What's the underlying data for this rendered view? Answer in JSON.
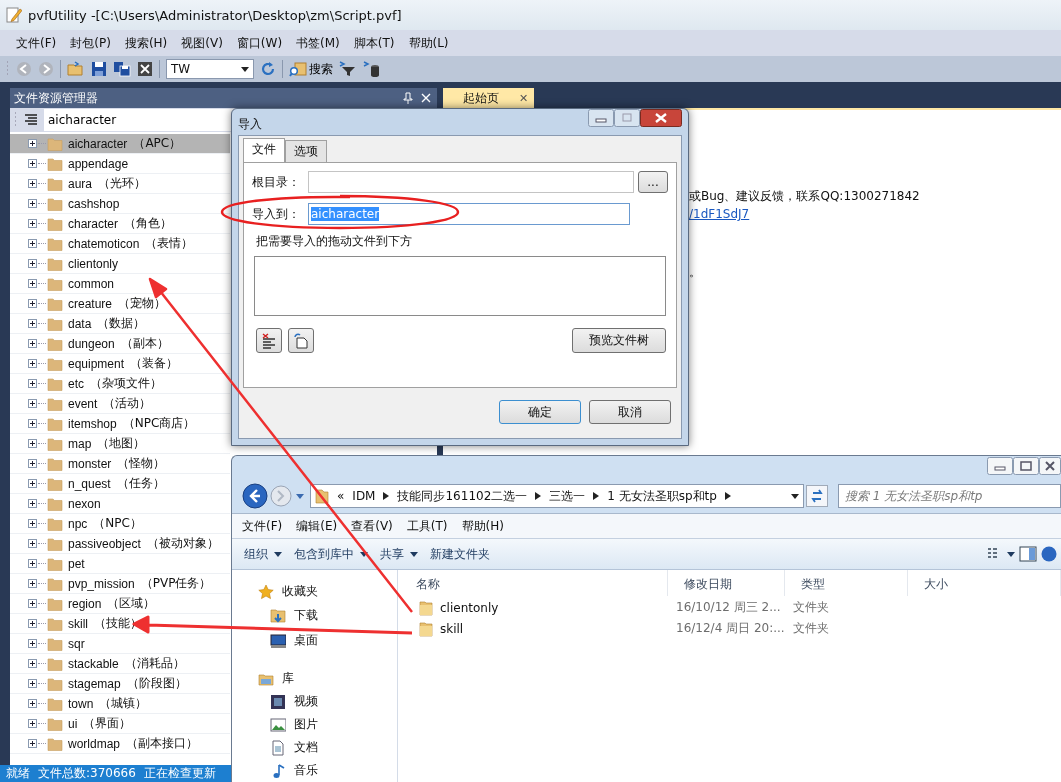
{
  "window": {
    "title": "pvfUtility -[C:\\Users\\Administrator\\Desktop\\zm\\Script.pvf]"
  },
  "menu": [
    "文件(F)",
    "封包(P)",
    "搜索(H)",
    "视图(V)",
    "窗口(W)",
    "书签(M)",
    "脚本(T)",
    "帮助(L)"
  ],
  "toolbar": {
    "back": {
      "disabled": true
    },
    "forward": {
      "disabled": true
    },
    "combo": {
      "value": "TW"
    },
    "search_label": "搜索"
  },
  "explorer_panel": {
    "title": "文件资源管理器",
    "search_value": "aicharacter",
    "items": [
      {
        "name": "aicharacter",
        "note": "（APC）",
        "selected": true,
        "expanded": false
      },
      {
        "name": "appendage",
        "selected": false,
        "expanded": false
      },
      {
        "name": "aura",
        "note": "（光环）",
        "selected": false,
        "expanded": false
      },
      {
        "name": "cashshop",
        "selected": false,
        "expanded": false
      },
      {
        "name": "character",
        "note": "（角色）",
        "selected": false,
        "expanded": false
      },
      {
        "name": "chatemoticon",
        "note": "（表情）",
        "selected": false,
        "expanded": false
      },
      {
        "name": "clientonly",
        "selected": false,
        "expanded": false
      },
      {
        "name": "common",
        "selected": false,
        "expanded": false
      },
      {
        "name": "creature",
        "note": "（宠物）",
        "selected": false,
        "expanded": false
      },
      {
        "name": "data",
        "note": "（数据）",
        "selected": false,
        "expanded": false
      },
      {
        "name": "dungeon",
        "note": "（副本）",
        "selected": false,
        "expanded": false
      },
      {
        "name": "equipment",
        "note": "（装备）",
        "selected": false,
        "expanded": false
      },
      {
        "name": "etc",
        "note": "（杂项文件）",
        "selected": false,
        "expanded": false
      },
      {
        "name": "event",
        "note": "（活动）",
        "selected": false,
        "expanded": false
      },
      {
        "name": "itemshop",
        "note": "（NPC商店）",
        "selected": false,
        "expanded": false
      },
      {
        "name": "map",
        "note": "（地图）",
        "selected": false,
        "expanded": false
      },
      {
        "name": "monster",
        "note": "（怪物）",
        "selected": false,
        "expanded": false
      },
      {
        "name": "n_quest",
        "note": "（任务）",
        "selected": false,
        "expanded": false
      },
      {
        "name": "nexon",
        "selected": false,
        "expanded": false
      },
      {
        "name": "npc",
        "note": "（NPC）",
        "selected": false,
        "expanded": false
      },
      {
        "name": "passiveobject",
        "note": "（被动对象）",
        "selected": false,
        "expanded": false
      },
      {
        "name": "pet",
        "selected": false,
        "expanded": false
      },
      {
        "name": "pvp_mission",
        "note": "（PVP任务）",
        "selected": false,
        "expanded": false
      },
      {
        "name": "region",
        "note": "（区域）",
        "selected": false,
        "expanded": false
      },
      {
        "name": "skill",
        "note": "（技能）",
        "selected": false,
        "expanded": false
      },
      {
        "name": "sqr",
        "selected": false,
        "expanded": false
      },
      {
        "name": "stackable",
        "note": "（消耗品）",
        "selected": false,
        "expanded": false
      },
      {
        "name": "stagemap",
        "note": "（阶段图）",
        "selected": false,
        "expanded": false
      },
      {
        "name": "town",
        "note": "（城镇）",
        "selected": false,
        "expanded": false
      },
      {
        "name": "ui",
        "note": "（界面）",
        "selected": false,
        "expanded": false
      },
      {
        "name": "worldmap",
        "note": "（副本接口）",
        "selected": false,
        "expanded": false
      }
    ]
  },
  "doc_tabs": [
    {
      "label": "起始页",
      "selected": true,
      "close": "✕"
    }
  ],
  "start_page": {
    "lines": [
      {
        "kind": "text",
        "text": "或Bug、建议反馈，联系QQ:1300271842"
      },
      {
        "kind": "link",
        "text": "/1dF1SdJ7"
      },
      {
        "kind": "gap"
      },
      {
        "kind": "gap"
      },
      {
        "kind": "text",
        "text": "。"
      }
    ]
  },
  "status_bar": [
    "就绪",
    "文件总数:370666",
    "正在检查更新"
  ],
  "import_dialog": {
    "title": "导入",
    "tabs": [
      {
        "label": "文件",
        "selected": true
      },
      {
        "label": "选项",
        "selected": false
      }
    ],
    "root_label": "根目录：",
    "browse_label": "...",
    "import_to_label": "导入到：",
    "import_to_value": "aicharacter",
    "value_selected": true,
    "hint": "把需要导入的拖动文件到下方",
    "preview_label": "预览文件树",
    "ok_label": "确定",
    "cancel_label": "取消"
  },
  "file_window": {
    "breadcrumb": [
      "«",
      "IDM",
      "技能同步161102二选一",
      "三选一",
      "1 无女法圣职sp和tp"
    ],
    "search_placeholder": "搜索 1 无女法圣职sp和tp",
    "menu": [
      "文件(F)",
      "编辑(E)",
      "查看(V)",
      "工具(T)",
      "帮助(H)"
    ],
    "commands": [
      {
        "label": "组织",
        "dropdown": true
      },
      {
        "label": "包含到库中",
        "dropdown": true
      },
      {
        "label": "共享",
        "dropdown": true
      },
      {
        "label": "新建文件夹",
        "dropdown": false
      }
    ],
    "nav": [
      {
        "label": "收藏夹",
        "children": [
          {
            "label": "下载"
          },
          {
            "label": "桌面"
          }
        ]
      },
      {
        "label": "库",
        "children": [
          {
            "label": "视频"
          },
          {
            "label": "图片"
          },
          {
            "label": "文档"
          },
          {
            "label": "音乐"
          }
        ]
      }
    ],
    "columns": [
      "名称",
      "修改日期",
      "类型",
      "大小"
    ],
    "rows": [
      {
        "name": "clientonly",
        "modified": "16/10/12 周三 2...",
        "type": "文件夹"
      },
      {
        "name": "skill",
        "modified": "16/12/4 周日 20:...",
        "type": "文件夹"
      }
    ]
  }
}
